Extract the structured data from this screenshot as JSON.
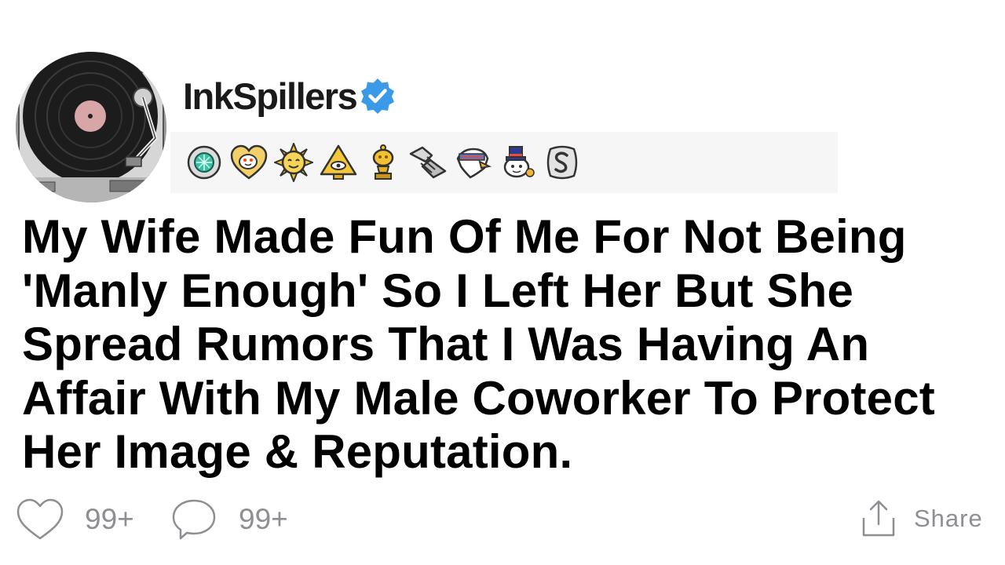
{
  "author": {
    "username": "InkSpillers",
    "verified": true,
    "avatar_icon": "turntable-avatar",
    "verified_icon": "verified-badge-icon",
    "verified_color": "#3a9ae8"
  },
  "awards": [
    {
      "icon": "silver-gem-award-icon"
    },
    {
      "icon": "wholesome-heart-award-icon"
    },
    {
      "icon": "sun-face-award-icon"
    },
    {
      "icon": "pyramid-eye-award-icon"
    },
    {
      "icon": "gold-trophy-award-icon"
    },
    {
      "icon": "handshake-award-icon"
    },
    {
      "icon": "eagle-award-icon"
    },
    {
      "icon": "snoo-top-hat-award-icon"
    },
    {
      "icon": "silver-s-award-icon"
    }
  ],
  "post": {
    "title": "My Wife Made Fun Of Me For Not Being 'Manly Enough' So I Left Her But She Spread Rumors That I Was Having An Affair With My Male Coworker To Protect Her Image & Reputation."
  },
  "footer": {
    "likes_count": "99+",
    "comments_count": "99+",
    "share_label": "Share",
    "like_icon": "heart-outline-icon",
    "comment_icon": "speech-bubble-icon",
    "share_icon": "share-upload-icon"
  },
  "colors": {
    "text": "#000000",
    "muted": "#8e8e93",
    "awards_background": "#f6f6f6"
  }
}
